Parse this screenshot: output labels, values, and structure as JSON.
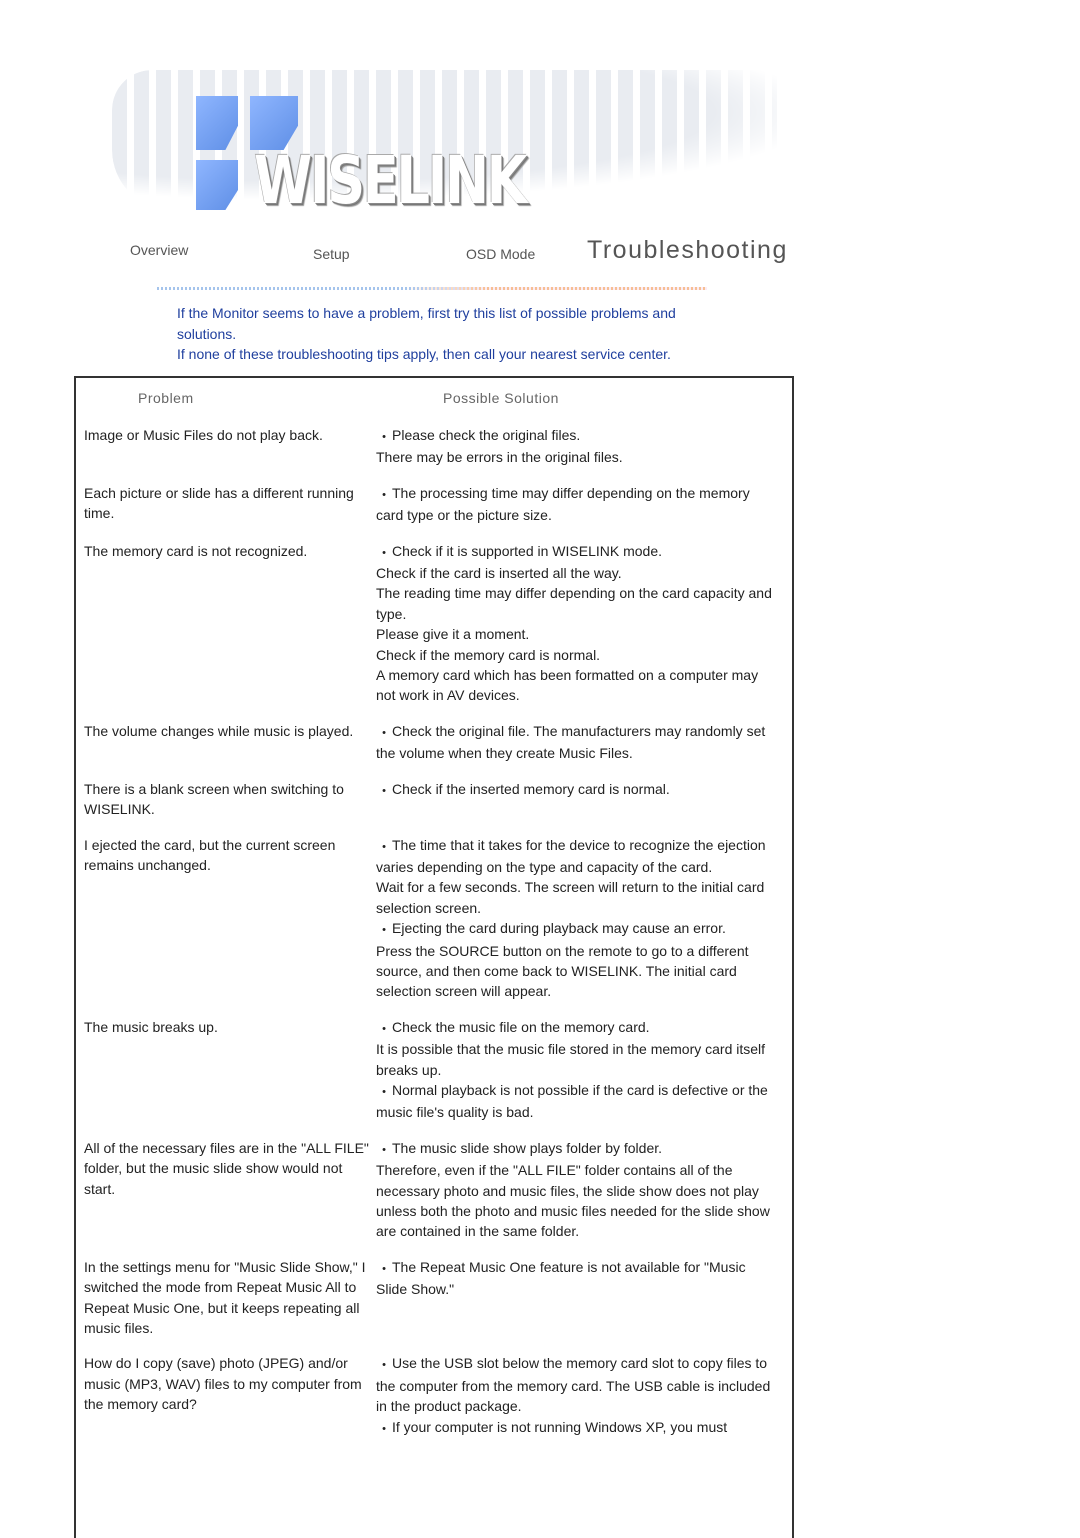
{
  "logo": {
    "text": "WISELINK"
  },
  "nav": {
    "items": [
      {
        "label": "Overview",
        "active": false
      },
      {
        "label": "Setup",
        "active": false
      },
      {
        "label": "OSD Mode",
        "active": false
      },
      {
        "label": "Troubleshooting",
        "active": true
      }
    ]
  },
  "colors": {
    "intro_text": "#1f3f9e",
    "dotline_start": "#8fb6e8",
    "dotline_end": "#f5b07a",
    "border": "#333333"
  },
  "intro": {
    "lines": [
      "If the Monitor seems to have a problem, first try this list of possible problems and solutions.",
      "If none of these troubleshooting tips apply, then call your nearest service center."
    ]
  },
  "table": {
    "headers": {
      "problem": "Problem",
      "solution": "Possible Solution"
    },
    "rows": [
      {
        "problem": "Image or Music Files do not play back.",
        "solution": [
          {
            "text": "Please check the original files.",
            "bullet": true
          },
          {
            "text": "There may be errors in the original files.",
            "bullet": false
          }
        ]
      },
      {
        "problem": "Each picture or slide has a different running time.",
        "solution": [
          {
            "text": "The processing time may differ depending on the memory card type or the picture size.",
            "bullet": true
          }
        ]
      },
      {
        "problem": "The memory card is not recognized.",
        "solution": [
          {
            "text": "Check if it is supported in WISELINK mode.",
            "bullet": true
          },
          {
            "text": "Check if the card is inserted all the way.",
            "bullet": false
          },
          {
            "text": "The reading time may differ depending on the card capacity and type.",
            "bullet": false
          },
          {
            "text": "Please give it a moment.",
            "bullet": false
          },
          {
            "text": "Check if the memory card is normal.",
            "bullet": false
          },
          {
            "text": "A memory card which has been formatted on a computer may not work in AV devices.",
            "bullet": false
          }
        ]
      },
      {
        "problem": "The volume changes while music is played.",
        "solution": [
          {
            "text": "Check the original file. The manufacturers may randomly set the volume when they create Music Files.",
            "bullet": true
          }
        ]
      },
      {
        "problem": "There is a blank screen when switching to WISELINK.",
        "solution": [
          {
            "text": "Check if the inserted memory card is normal.",
            "bullet": true
          }
        ]
      },
      {
        "problem": "I ejected the card, but the current screen remains unchanged.",
        "solution": [
          {
            "text": "The time that it takes for the device to recognize the ejection varies depending on the type and capacity of the card.",
            "bullet": true
          },
          {
            "text": "Wait for a few seconds. The screen will return to the initial card selection screen.",
            "bullet": false
          },
          {
            "text": "Ejecting the card during playback may cause an error.",
            "bullet": true
          },
          {
            "text": "Press the SOURCE button on the remote to go to a different source, and then come back to WISELINK. The initial card selection screen will appear.",
            "bullet": false
          }
        ]
      },
      {
        "problem": "The music breaks up.",
        "solution": [
          {
            "text": "Check the music file on the memory card.",
            "bullet": true
          },
          {
            "text": "It is possible that the music file stored in the memory card itself breaks up.",
            "bullet": false
          },
          {
            "text": "Normal playback is not possible if the card is defective or the music file's quality is bad.",
            "bullet": true
          }
        ]
      },
      {
        "problem": "All of the necessary files are in the \"ALL FILE\" folder, but the music slide show would not start.",
        "solution": [
          {
            "text": "The music slide show plays folder by folder.",
            "bullet": true
          },
          {
            "text": "Therefore, even if the \"ALL FILE\" folder contains all of the necessary photo and music files, the slide show does not play unless both the photo and music files needed for the slide show are contained in the same folder.",
            "bullet": false
          }
        ]
      },
      {
        "problem": "In the settings menu for \"Music Slide Show,\" I switched the mode from Repeat Music All to Repeat Music One, but it keeps repeating all music files.",
        "solution": [
          {
            "text": "The Repeat Music One feature is not available for \"Music Slide Show.\"",
            "bullet": true
          }
        ]
      },
      {
        "problem": "How do I copy (save) photo (JPEG) and/or music (MP3, WAV) files to my computer from the memory card?",
        "solution": [
          {
            "text": "Use the USB slot below the memory card slot to copy files to the computer from the memory card. The USB cable is included in the product package.",
            "bullet": true
          },
          {
            "text": "If your computer is not running Windows XP, you must",
            "bullet": true
          }
        ]
      }
    ]
  }
}
